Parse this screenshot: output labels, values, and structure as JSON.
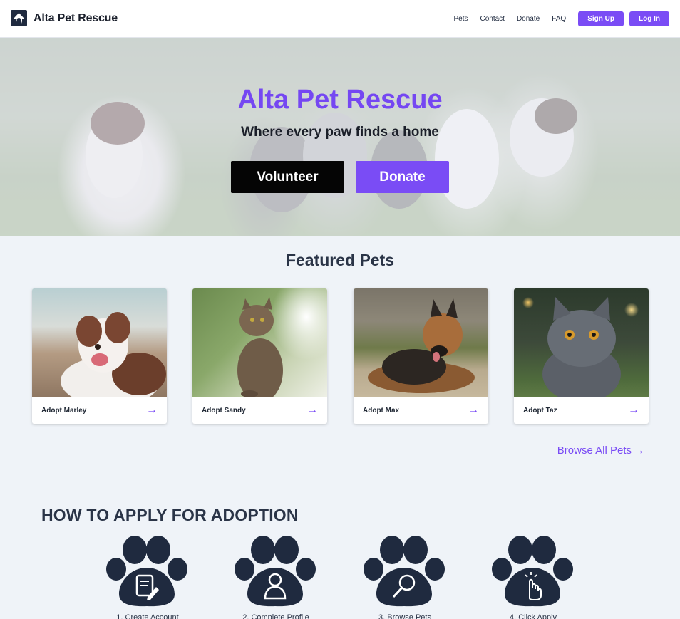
{
  "header": {
    "brand": "Alta Pet Rescue",
    "nav": [
      "Pets",
      "Contact",
      "Donate",
      "FAQ"
    ],
    "signup_label": "Sign Up",
    "login_label": "Log In"
  },
  "hero": {
    "title": "Alta Pet Rescue",
    "subtitle": "Where every paw finds a home",
    "volunteer_label": "Volunteer",
    "donate_label": "Donate"
  },
  "featured": {
    "title": "Featured Pets",
    "cards": [
      {
        "label": "Adopt Marley"
      },
      {
        "label": "Adopt Sandy"
      },
      {
        "label": "Adopt Max"
      },
      {
        "label": "Adopt Taz"
      }
    ],
    "browse_label": "Browse All Pets"
  },
  "how_to_apply": {
    "title": "HOW TO APPLY FOR ADOPTION",
    "steps": [
      {
        "label": "1. Create Account",
        "icon": "document-pen-icon"
      },
      {
        "label": "2. Complete Profile",
        "icon": "user-icon"
      },
      {
        "label": "3. Browse Pets",
        "icon": "search-icon"
      },
      {
        "label": "4. Click Apply",
        "icon": "click-hand-icon"
      }
    ]
  },
  "colors": {
    "accent": "#7a4cf5",
    "dark": "#1f2a3f",
    "background": "#eff3f8"
  }
}
